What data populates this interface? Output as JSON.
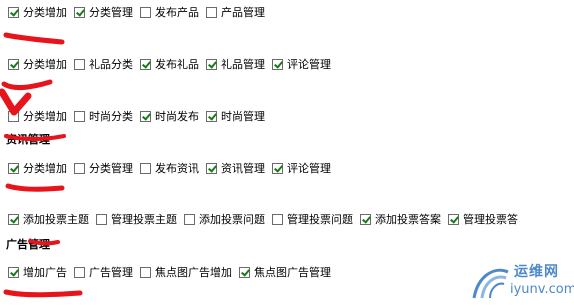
{
  "rows": [
    {
      "items": [
        {
          "label": "分类增加",
          "checked": true
        },
        {
          "label": "分类管理",
          "checked": true
        },
        {
          "label": "发布产品",
          "checked": false
        },
        {
          "label": "产品管理",
          "checked": false
        }
      ]
    },
    {
      "items": [
        {
          "label": "分类增加",
          "checked": true
        },
        {
          "label": "礼品分类",
          "checked": false
        },
        {
          "label": "发布礼品",
          "checked": true
        },
        {
          "label": "礼品管理",
          "checked": true
        },
        {
          "label": "评论管理",
          "checked": true
        }
      ]
    },
    {
      "items": [
        {
          "label": "分类增加",
          "checked": false
        },
        {
          "label": "时尚分类",
          "checked": false
        },
        {
          "label": "时尚发布",
          "checked": true
        },
        {
          "label": "时尚管理",
          "checked": true
        }
      ]
    },
    {
      "items": [
        {
          "label": "分类增加",
          "checked": true
        },
        {
          "label": "分类管理",
          "checked": false
        },
        {
          "label": "发布资讯",
          "checked": false
        },
        {
          "label": "资讯管理",
          "checked": true
        },
        {
          "label": "评论管理",
          "checked": true
        }
      ]
    },
    {
      "items": [
        {
          "label": "添加投票主题",
          "checked": true
        },
        {
          "label": "管理投票主题",
          "checked": false
        },
        {
          "label": "添加投票问题",
          "checked": false
        },
        {
          "label": "管理投票问题",
          "checked": false
        },
        {
          "label": "添加投票答案",
          "checked": true
        },
        {
          "label": "管理投票答",
          "checked": true
        }
      ]
    },
    {
      "items": [
        {
          "label": "增加广告",
          "checked": true
        },
        {
          "label": "广告管理",
          "checked": false
        },
        {
          "label": "焦点图广告增加",
          "checked": false
        },
        {
          "label": "焦点图广告管理",
          "checked": true
        }
      ]
    }
  ],
  "headings": {
    "resource": "资讯管理",
    "ads": "广告管理"
  },
  "watermark": {
    "title": "运维网",
    "url": "iyunv.com"
  },
  "colors": {
    "redaction": "#e8141c",
    "watermark": "#4d88c9"
  }
}
